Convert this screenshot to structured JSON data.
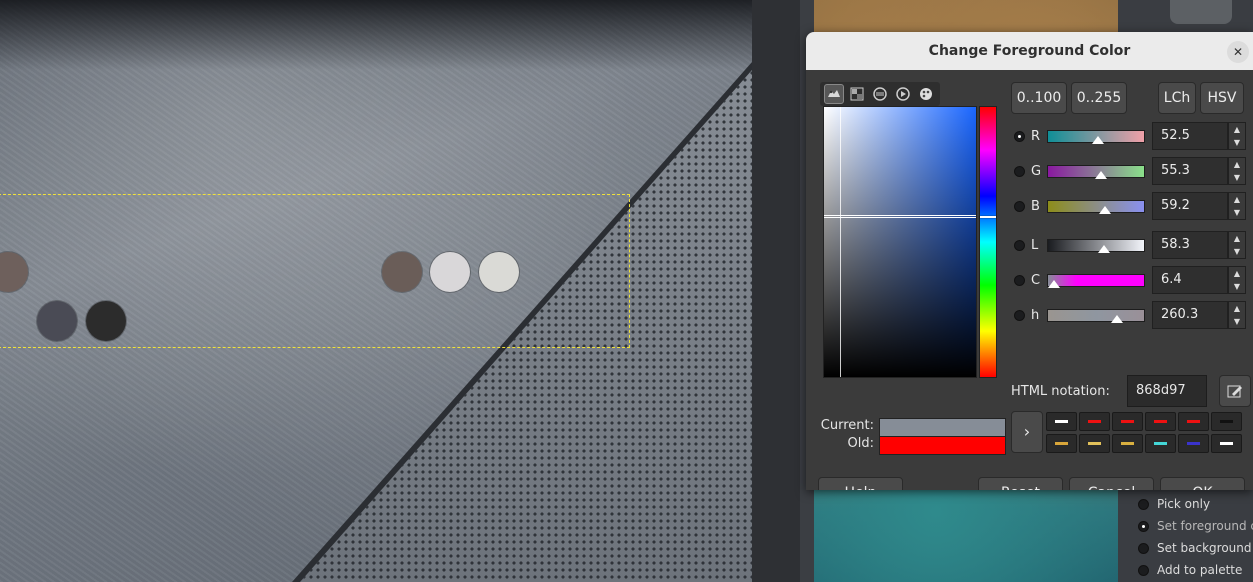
{
  "dialog": {
    "title": "Change Foreground Color",
    "close_symbol": "✕",
    "range_buttons": [
      "0..100",
      "0..255"
    ],
    "model_buttons": [
      "LCh",
      "HSV"
    ],
    "selector_icons": [
      "wilber-selector-icon",
      "cmyk-selector-icon",
      "watercolor-selector-icon",
      "triangle-selector-icon",
      "palette-selector-icon"
    ],
    "channels": [
      {
        "label": "R",
        "value": "52.5",
        "selected": true,
        "fraction": 0.525,
        "gradient": "linear-gradient(to right, #0f8f97, #f0a0a8)"
      },
      {
        "label": "G",
        "value": "55.3",
        "selected": false,
        "fraction": 0.553,
        "gradient": "linear-gradient(to right, #8a18a0, #8ae08a)"
      },
      {
        "label": "B",
        "value": "59.2",
        "selected": false,
        "fraction": 0.592,
        "gradient": "linear-gradient(to right, #8d8d1a, #8a90f0)"
      },
      {
        "label": "L",
        "value": "58.3",
        "selected": false,
        "fraction": 0.583,
        "gradient": "linear-gradient(to right, #1a1c20, #f2f4fa)"
      },
      {
        "label": "C",
        "value": "6.4",
        "selected": false,
        "fraction": 0.064,
        "gradient": "linear-gradient(to right, #868d97, #ff00ff 30%, #ff00ff)"
      },
      {
        "label": "h",
        "value": "260.3",
        "selected": false,
        "fraction": 0.723,
        "gradient": "linear-gradient(to right, #9a9590, #8f96a0, #9a9098)"
      }
    ],
    "html_notation_label": "HTML notation:",
    "html_notation_value": "868d97",
    "current_label": "Current:",
    "old_label": "Old:",
    "current_color": "#868d97",
    "old_color": "#ff0000",
    "history_colors": [
      "#ffffff",
      "#e11",
      "#e11",
      "#e11",
      "#e11",
      "#111111",
      "#d9a63a",
      "#e2c15a",
      "#d9b040",
      "#44d6d6",
      "#3a33cc",
      "#ffffff"
    ],
    "buttons": {
      "help": "Help",
      "reset": "Reset",
      "cancel": "Cancel",
      "ok": "OK"
    }
  },
  "tool_options": {
    "items": [
      {
        "label": "Pick only",
        "selected": false
      },
      {
        "label": "Set foreground c",
        "selected": true
      },
      {
        "label": "Set background c",
        "selected": false
      },
      {
        "label": "Add to palette",
        "selected": false
      }
    ]
  },
  "canvas": {
    "picked_dots": [
      "#6e605c",
      "#4a4b55",
      "#2c2c2c",
      "#6a5d58",
      "#d9d7d9",
      "#dadad6"
    ]
  }
}
